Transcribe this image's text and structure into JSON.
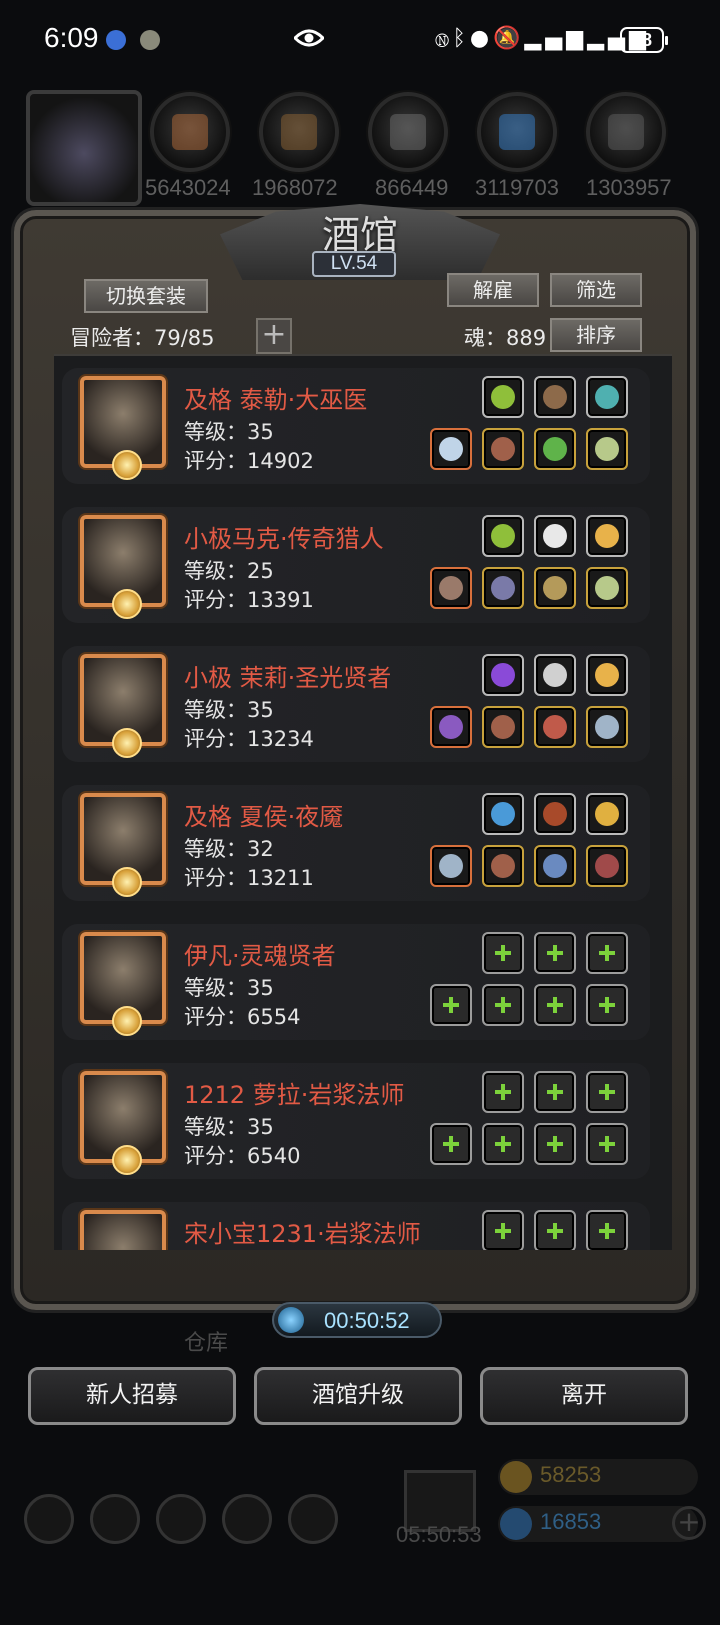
{
  "status_bar": {
    "time": "6:09",
    "battery": "88",
    "icons": [
      "app-icon",
      "app-icon",
      "eye-icon",
      "nfc-icon",
      "bluetooth-icon",
      "location-icon",
      "mute-icon",
      "signal-icon",
      "signal-icon"
    ]
  },
  "resources": [
    {
      "icon": "helmet-resource-icon",
      "value": "5643024"
    },
    {
      "icon": "wood-resource-icon",
      "value": "1968072"
    },
    {
      "icon": "iron-resource-icon",
      "value": "866449"
    },
    {
      "icon": "crystal-resource-icon",
      "value": "3119703"
    },
    {
      "icon": "stone-resource-icon",
      "value": "1303957"
    }
  ],
  "tavern": {
    "title": "酒馆",
    "level": "LV.54",
    "switch_outfit": "切换套装",
    "dismiss": "解雇",
    "filter": "筛选",
    "sort": "排序",
    "adventurers_label": "冒险者：79/85",
    "soul_label": "魂：889",
    "heroes": [
      {
        "name": "及格 泰勒·大巫医",
        "level": "等级：35",
        "score": "评分：14902",
        "top_slots": [
          "gold-flame-icon",
          "dagger-icon",
          "stone-icon"
        ],
        "bottom_slots": [
          "staff-icon",
          "armor-icon",
          "frog-icon",
          "ring-icon"
        ]
      },
      {
        "name": "小极马克·传奇猎人",
        "level": "等级：25",
        "score": "评分：13391",
        "top_slots": [
          "gold-flame-icon",
          "wing-icon",
          "lantern-icon"
        ],
        "bottom_slots": [
          "bow-icon",
          "helm-icon",
          "shield-icon",
          "ring-icon"
        ]
      },
      {
        "name": "小极 茉莉·圣光贤者",
        "level": "等级：35",
        "score": "评分：13234",
        "top_slots": [
          "purple-orb-icon",
          "emblem-icon",
          "lantern-icon"
        ],
        "bottom_slots": [
          "wand-icon",
          "armor-icon",
          "amulet-icon",
          "spear-icon"
        ]
      },
      {
        "name": "及格 夏侯·夜魇",
        "level": "等级：32",
        "score": "评分：13211",
        "top_slots": [
          "blue-orb-icon",
          "spider-icon",
          "gold-apple-icon"
        ],
        "bottom_slots": [
          "spear-icon",
          "armor-icon",
          "claw-icon",
          "gauntlet-icon"
        ]
      },
      {
        "name": "伊凡·灵魂贤者",
        "level": "等级：35",
        "score": "评分：6554",
        "top_slots": [
          "add-slot-icon",
          "add-slot-icon",
          "add-slot-icon"
        ],
        "bottom_slots": [
          "add-slot-icon",
          "add-slot-icon",
          "add-slot-icon",
          "add-slot-icon"
        ]
      },
      {
        "name": "1212 萝拉·岩浆法师",
        "level": "等级：35",
        "score": "评分：6540",
        "top_slots": [
          "add-slot-icon",
          "add-slot-icon",
          "add-slot-icon"
        ],
        "bottom_slots": [
          "add-slot-icon",
          "add-slot-icon",
          "add-slot-icon",
          "add-slot-icon"
        ]
      },
      {
        "name": "宋小宝1231·岩浆法师",
        "level": "",
        "score": "",
        "top_slots": [
          "add-slot-icon",
          "add-slot-icon",
          "add-slot-icon"
        ],
        "bottom_slots": []
      }
    ],
    "timer": "00:50:52"
  },
  "bottom_buttons": {
    "recruit": "新人招募",
    "upgrade": "酒馆升级",
    "leave": "离开"
  },
  "background": {
    "warehouse_label": "仓库",
    "gift_timer": "05:50:53",
    "gold": "58253",
    "gems": "16853"
  },
  "colors": {
    "hero_name": "#e25a45",
    "slot_plus": "#7cd23b",
    "timer_text": "#a9e2ff"
  }
}
